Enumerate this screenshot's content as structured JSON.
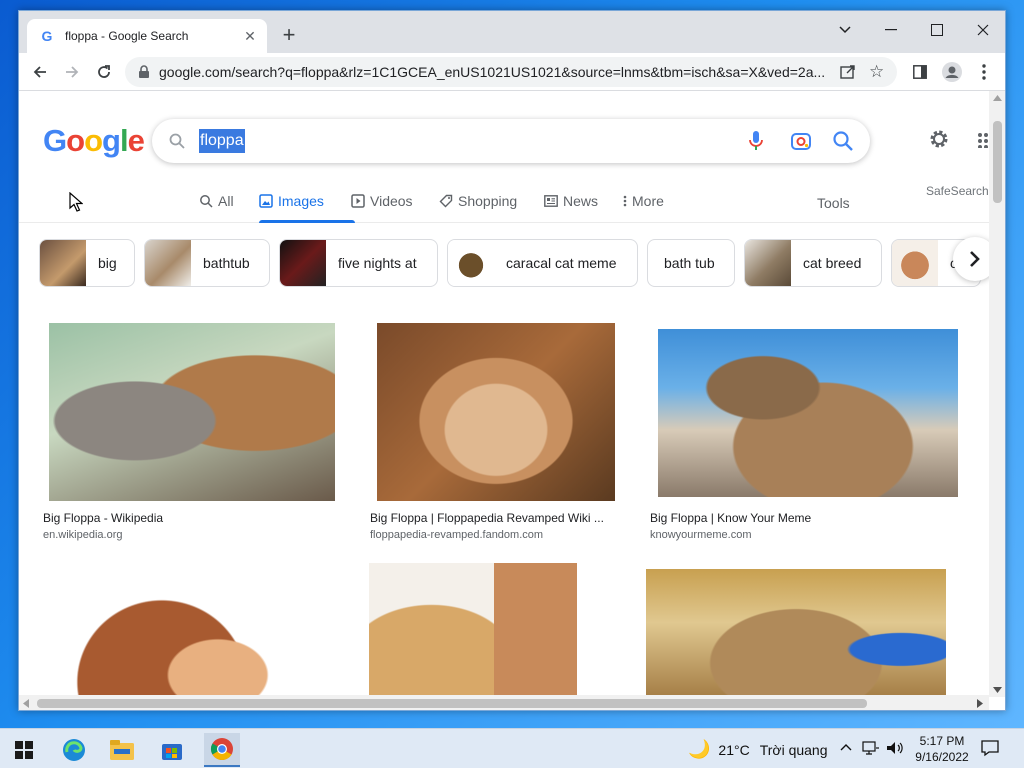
{
  "browser": {
    "tab_title": "floppa - Google Search",
    "url": "google.com/search?q=floppa&rlz=1C1GCEA_enUS1021US1021&source=lnms&tbm=isch&sa=X&ved=2a..."
  },
  "search": {
    "logo": {
      "G": "G",
      "o1": "o",
      "o2": "o",
      "g": "g",
      "l": "l",
      "e": "e"
    },
    "query": "floppa"
  },
  "tabs": [
    {
      "label": "All",
      "icon": "search-icon"
    },
    {
      "label": "Images",
      "icon": "image-icon",
      "active": true
    },
    {
      "label": "Videos",
      "icon": "play-icon"
    },
    {
      "label": "Shopping",
      "icon": "tag-icon"
    },
    {
      "label": "News",
      "icon": "news-icon"
    },
    {
      "label": "More",
      "icon": "more-vert-icon"
    }
  ],
  "tools_label": "Tools",
  "safesearch_label": "SafeSearch",
  "chips": [
    {
      "label": "big"
    },
    {
      "label": "bathtub"
    },
    {
      "label": "five nights at"
    },
    {
      "label": "caracal cat meme"
    },
    {
      "label": "bath tub"
    },
    {
      "label": "cat breed"
    },
    {
      "label": "c"
    }
  ],
  "results": [
    {
      "title": "Big Floppa - Wikipedia",
      "source": "en.wikipedia.org"
    },
    {
      "title": "Big Floppa | Floppapedia Revamped Wiki ...",
      "source": "floppapedia-revamped.fandom.com"
    },
    {
      "title": "Big Floppa | Know Your Meme",
      "source": "knowyourmeme.com"
    },
    {
      "title": "",
      "source": ""
    },
    {
      "title": "",
      "source": ""
    },
    {
      "title": "",
      "source": ""
    }
  ],
  "taskbar": {
    "weather_temp": "21°C",
    "weather_text": "Trời quang",
    "time": "5:17 PM",
    "date": "9/16/2022"
  },
  "colors": {
    "google_blue": "#4285f4",
    "google_red": "#ea4335",
    "google_yellow": "#fbbc05",
    "google_green": "#34a853",
    "active_tab": "#1a73e8"
  }
}
